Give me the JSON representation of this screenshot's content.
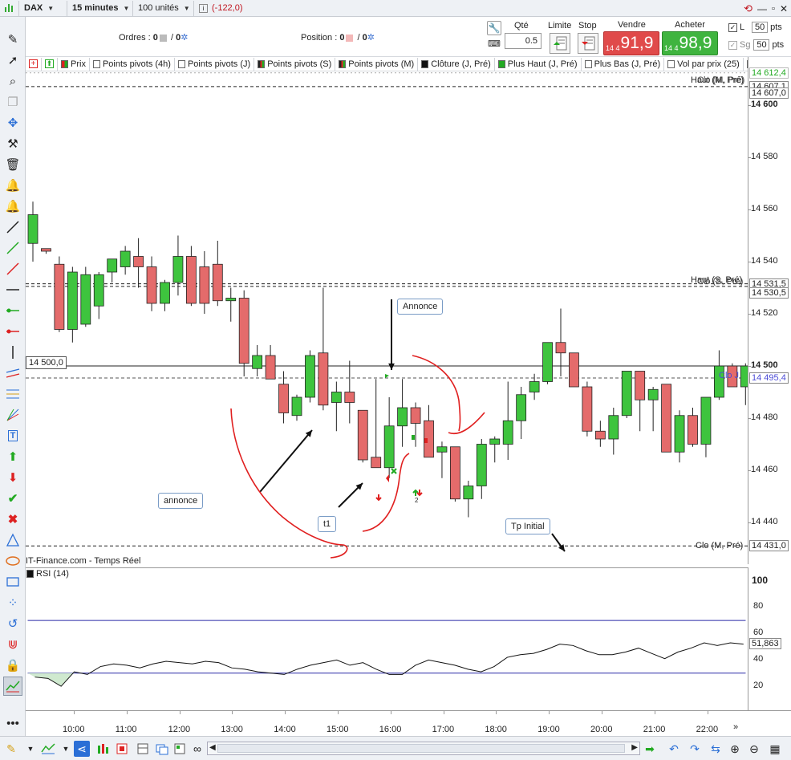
{
  "topbar": {
    "symbol": "DAX",
    "timeframe": "15 minutes",
    "units": "100 unités",
    "pnl": "(-122,0)"
  },
  "orders": {
    "label": "Ordres :",
    "val1": "0",
    "sep": "/",
    "val2": "0"
  },
  "position": {
    "label": "Position :",
    "val1": "0",
    "sep": "/",
    "val2": "0"
  },
  "trade": {
    "qty_label": "Qté",
    "qty_value": "0.5",
    "limit_label": "Limite",
    "stop_label": "Stop",
    "sell_label": "Vendre",
    "sell_prefix": "14 4",
    "sell_price": "91,9",
    "buy_label": "Acheter",
    "buy_prefix": "14 4",
    "buy_price": "98,9",
    "l_label": "L",
    "l_value": "50",
    "l_unit": "pts",
    "sg_label": "Sg",
    "sg_value": "50",
    "sg_unit": "pts"
  },
  "indicators": [
    "Prix",
    "Points pivots (4h)",
    "Points pivots (J)",
    "Points pivots (S)",
    "Points pivots (M)",
    "Clôture (J, Pré)",
    "Plus Haut (J, Pré)",
    "Plus Bas (J, Pré)",
    "Vol par prix (25)",
    "Pi"
  ],
  "price_axis": {
    "ticks": [
      "14 600",
      "14 580",
      "14 560",
      "14 540",
      "14 520",
      "14 500",
      "14 480",
      "14 460",
      "14 440"
    ],
    "tags": [
      "14 612,4",
      "14 607,1",
      "14 607,0",
      "14 531,5",
      "14 530,5",
      "14 495,4",
      "14 431,0"
    ]
  },
  "level_labels": {
    "haut_m": "Haut (M, Pré)",
    "clo_m_top": "Clo (M, Pré)",
    "haut_s": "Haut (S, Pré)",
    "clo_s": "Clo (S, Pré)",
    "clo_j": "Clo J",
    "clo_m_bottom": "Clo (M, Pré)",
    "hline_price": "14 500,0"
  },
  "annotations": {
    "annonce_top": "Annonce",
    "annonce_left": "annonce",
    "t1": "t1",
    "tp": "Tp Initial",
    "order_count": "2"
  },
  "rsi": {
    "source": "IT-Finance.com - Temps Réel",
    "title": "RSI (14)",
    "ticks": [
      "100",
      "80",
      "60",
      "40",
      "20"
    ],
    "value": "51,863"
  },
  "time_axis": [
    "10:00",
    "11:00",
    "12:00",
    "13:00",
    "14:00",
    "15:00",
    "16:00",
    "17:00",
    "18:00",
    "19:00",
    "20:00",
    "21:00",
    "22:00"
  ],
  "chart_data": {
    "type": "candlestick",
    "ylim": [
      14420,
      14615
    ],
    "up_color": "#3ec43e",
    "down_color": "#e46b6b",
    "candles": [
      {
        "t": "09:30",
        "o": 14547,
        "h": 14563,
        "l": 14540,
        "c": 14558
      },
      {
        "t": "09:45",
        "o": 14545,
        "h": 14545,
        "l": 14543,
        "c": 14544
      },
      {
        "t": "10:00",
        "o": 14539,
        "h": 14542,
        "l": 14513,
        "c": 14514
      },
      {
        "t": "10:15",
        "o": 14514,
        "h": 14538,
        "l": 14509,
        "c": 14536
      },
      {
        "t": "10:30",
        "o": 14516,
        "h": 14538,
        "l": 14515,
        "c": 14535
      },
      {
        "t": "10:45",
        "o": 14523,
        "h": 14536,
        "l": 14518,
        "c": 14535
      },
      {
        "t": "11:00",
        "o": 14536,
        "h": 14541,
        "l": 14532,
        "c": 14541
      },
      {
        "t": "11:15",
        "o": 14538,
        "h": 14546,
        "l": 14535,
        "c": 14544
      },
      {
        "t": "11:30",
        "o": 14542,
        "h": 14549,
        "l": 14530,
        "c": 14538
      },
      {
        "t": "11:45",
        "o": 14538,
        "h": 14542,
        "l": 14521,
        "c": 14524
      },
      {
        "t": "12:00",
        "o": 14524,
        "h": 14533,
        "l": 14521,
        "c": 14532
      },
      {
        "t": "12:15",
        "o": 14532,
        "h": 14550,
        "l": 14527,
        "c": 14542
      },
      {
        "t": "12:30",
        "o": 14542,
        "h": 14546,
        "l": 14523,
        "c": 14524
      },
      {
        "t": "12:45",
        "o": 14538,
        "h": 14544,
        "l": 14520,
        "c": 14524
      },
      {
        "t": "13:00",
        "o": 14539,
        "h": 14548,
        "l": 14523,
        "c": 14525
      },
      {
        "t": "13:15",
        "o": 14525,
        "h": 14530,
        "l": 14517,
        "c": 14526
      },
      {
        "t": "13:30",
        "o": 14526,
        "h": 14529,
        "l": 14496,
        "c": 14501
      },
      {
        "t": "13:45",
        "o": 14499,
        "h": 14508,
        "l": 14496,
        "c": 14504
      },
      {
        "t": "14:00",
        "o": 14504,
        "h": 14508,
        "l": 14495,
        "c": 14495
      },
      {
        "t": "14:15",
        "o": 14493,
        "h": 14498,
        "l": 14478,
        "c": 14482
      },
      {
        "t": "14:30",
        "o": 14481,
        "h": 14489,
        "l": 14479,
        "c": 14488
      },
      {
        "t": "14:45",
        "o": 14488,
        "h": 14506,
        "l": 14486,
        "c": 14504
      },
      {
        "t": "15:00",
        "o": 14505,
        "h": 14530,
        "l": 14483,
        "c": 14485
      },
      {
        "t": "15:15",
        "o": 14486,
        "h": 14494,
        "l": 14475,
        "c": 14490
      },
      {
        "t": "15:30",
        "o": 14490,
        "h": 14502,
        "l": 14478,
        "c": 14486
      },
      {
        "t": "15:45",
        "o": 14483,
        "h": 14483,
        "l": 14463,
        "c": 14464
      },
      {
        "t": "16:00",
        "o": 14465,
        "h": 14495,
        "l": 14462,
        "c": 14461
      },
      {
        "t": "16:15",
        "o": 14461,
        "h": 14488,
        "l": 14457,
        "c": 14477
      },
      {
        "t": "16:30",
        "o": 14477,
        "h": 14495,
        "l": 14469,
        "c": 14484
      },
      {
        "t": "16:45",
        "o": 14484,
        "h": 14486,
        "l": 14469,
        "c": 14478
      },
      {
        "t": "17:00",
        "o": 14479,
        "h": 14485,
        "l": 14465,
        "c": 14465
      },
      {
        "t": "17:15",
        "o": 14467,
        "h": 14471,
        "l": 14457,
        "c": 14469
      },
      {
        "t": "17:30",
        "o": 14469,
        "h": 14469,
        "l": 14448,
        "c": 14449
      },
      {
        "t": "17:45",
        "o": 14449,
        "h": 14456,
        "l": 14442,
        "c": 14454
      },
      {
        "t": "18:00",
        "o": 14454,
        "h": 14472,
        "l": 14449,
        "c": 14470
      },
      {
        "t": "18:15",
        "o": 14470,
        "h": 14473,
        "l": 14463,
        "c": 14472
      },
      {
        "t": "18:30",
        "o": 14470,
        "h": 14494,
        "l": 14464,
        "c": 14479
      },
      {
        "t": "18:45",
        "o": 14479,
        "h": 14492,
        "l": 14472,
        "c": 14489
      },
      {
        "t": "19:00",
        "o": 14490,
        "h": 14497,
        "l": 14487,
        "c": 14494
      },
      {
        "t": "19:15",
        "o": 14494,
        "h": 14509,
        "l": 14493,
        "c": 14509
      },
      {
        "t": "19:30",
        "o": 14509,
        "h": 14522,
        "l": 14496,
        "c": 14505
      },
      {
        "t": "19:45",
        "o": 14505,
        "h": 14505,
        "l": 14492,
        "c": 14492
      },
      {
        "t": "20:00",
        "o": 14492,
        "h": 14494,
        "l": 14473,
        "c": 14475
      },
      {
        "t": "20:15",
        "o": 14475,
        "h": 14479,
        "l": 14469,
        "c": 14472
      },
      {
        "t": "20:30",
        "o": 14472,
        "h": 14484,
        "l": 14466,
        "c": 14481
      },
      {
        "t": "20:45",
        "o": 14481,
        "h": 14498,
        "l": 14480,
        "c": 14498
      },
      {
        "t": "21:00",
        "o": 14498,
        "h": 14498,
        "l": 14475,
        "c": 14487
      },
      {
        "t": "21:15",
        "o": 14487,
        "h": 14492,
        "l": 14475,
        "c": 14491
      },
      {
        "t": "21:30",
        "o": 14493,
        "h": 14493,
        "l": 14467,
        "c": 14467
      },
      {
        "t": "21:45",
        "o": 14467,
        "h": 14483,
        "l": 14463,
        "c": 14481
      },
      {
        "t": "22:00",
        "o": 14481,
        "h": 14484,
        "l": 14469,
        "c": 14470
      },
      {
        "t": "22:15",
        "o": 14470,
        "h": 14488,
        "l": 14465,
        "c": 14488
      },
      {
        "t": "22:30",
        "o": 14488,
        "h": 14506,
        "l": 14487,
        "c": 14500
      },
      {
        "t": "22:45",
        "o": 14500,
        "h": 14501,
        "l": 14492,
        "c": 14492
      },
      {
        "t": "23:00",
        "o": 14492,
        "h": 14501,
        "l": 14485,
        "c": 14500
      }
    ],
    "levels": [
      {
        "name": "Haut (M, Pré)",
        "value": 14607.1,
        "style": "dashed"
      },
      {
        "name": "Haut (S, Pré)",
        "value": 14531.5,
        "style": "dashed"
      },
      {
        "name": "Clo (S, Pré)",
        "value": 14530.5,
        "style": "dashed"
      },
      {
        "name": "hline",
        "value": 14500.0,
        "style": "solid"
      },
      {
        "name": "Clo J",
        "value": 14495.4,
        "style": "dashed"
      },
      {
        "name": "Clo (M, Pré)",
        "value": 14431.0,
        "style": "dashed"
      }
    ],
    "rsi": {
      "ylim": [
        0,
        100
      ],
      "levels": [
        70,
        30
      ],
      "values": [
        27,
        26,
        20,
        31,
        29,
        35,
        37,
        36,
        34,
        37,
        39,
        38,
        37,
        39,
        38,
        34,
        33,
        31,
        30,
        29,
        33,
        36,
        38,
        40,
        36,
        38,
        33,
        29,
        29,
        36,
        40,
        38,
        36,
        33,
        31,
        35,
        42,
        44,
        45,
        48,
        52,
        51,
        47,
        44,
        44,
        46,
        49,
        45,
        41,
        46,
        49,
        53,
        51,
        53,
        52
      ]
    }
  }
}
